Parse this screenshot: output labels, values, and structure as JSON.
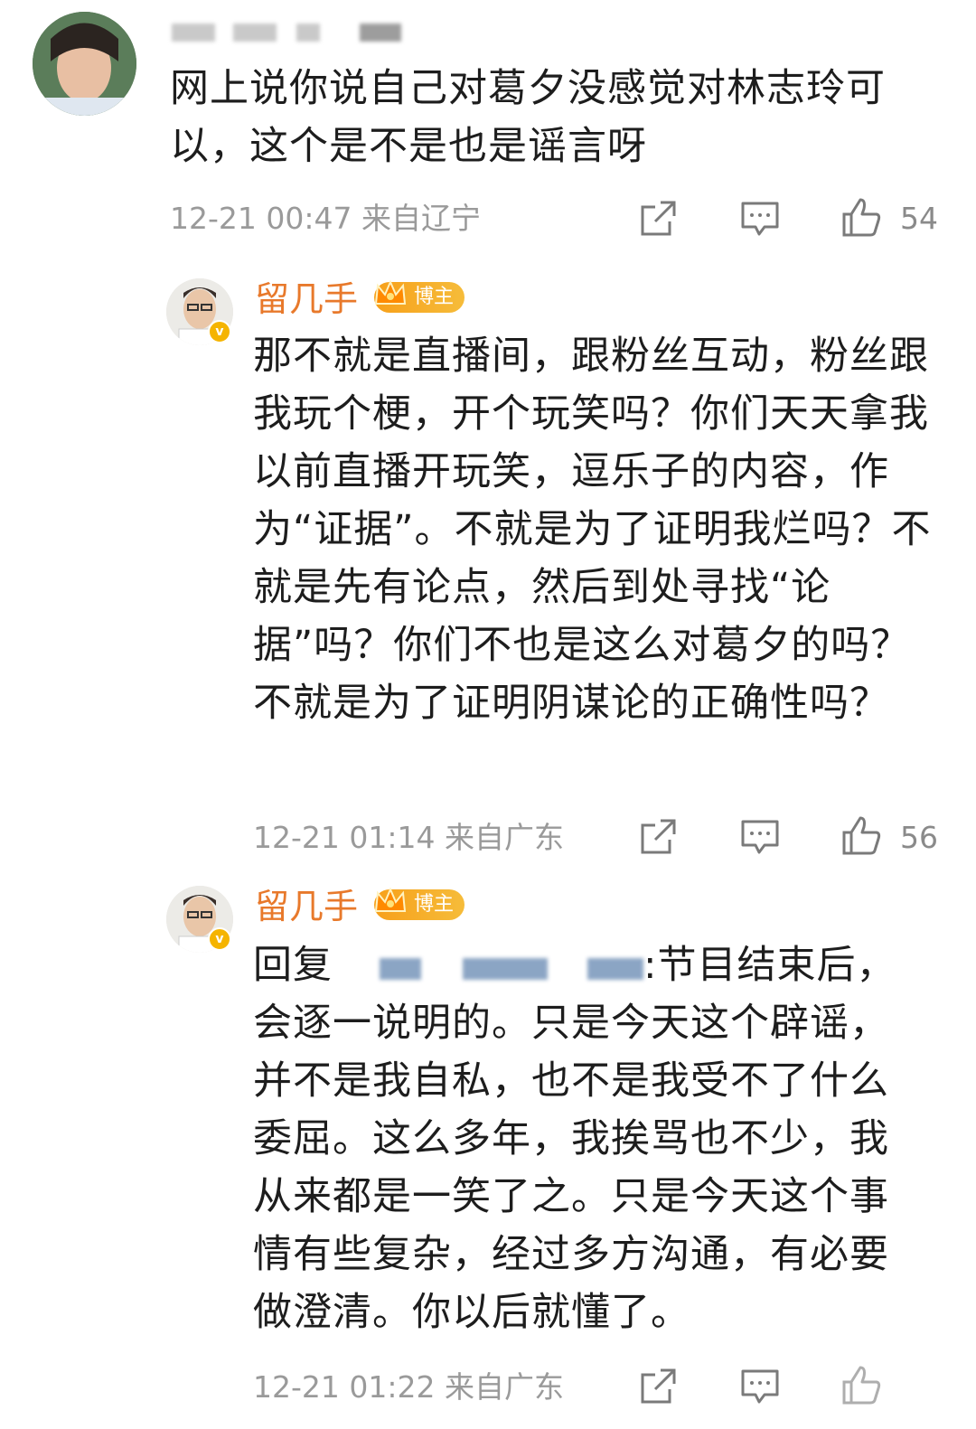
{
  "comment": {
    "text": "网上说你说自己对葛夕没感觉对林志玲可以，这个是不是也是谣言呀",
    "timestamp": "12-21 00:47",
    "location": "来自辽宁",
    "likes": "54"
  },
  "replies": [
    {
      "author": "留几手",
      "badge": "博主",
      "text": "那不就是直播间，跟粉丝互动，粉丝跟我玩个梗，开个玩笑吗？你们天天拿我以前直播开玩笑，逗乐子的内容，作为“证据”。不就是为了证明我烂吗？不就是先有论点，然后到处寻找“论据”吗？你们不也是这么对葛夕的吗？不就是为了证明阴谋论的正确性吗？",
      "timestamp": "12-21 01:14",
      "location": "来自广东",
      "likes": "56"
    },
    {
      "author": "留几手",
      "badge": "博主",
      "reply_prefix": "回复",
      "reply_tail": ":节目结束后，",
      "text": "会逐一说明的。只是今天这个辟谣，并不是我自私，也不是我受不了什么委屈。这么多年，我挨骂也不少，我从来都是一笑了之。只是今天这个事情有些复杂，经过多方沟通，有必要做澄清。你以后就懂了。",
      "timestamp": "12-21 01:22",
      "location": "来自广东"
    }
  ],
  "icons": {
    "share": "share-icon",
    "comment": "comment-icon",
    "like": "thumbs-up-icon",
    "crown": "crown-icon"
  },
  "colors": {
    "author": "#e8792b",
    "badge": "#f7a01a",
    "meta": "#9a9a9a"
  }
}
